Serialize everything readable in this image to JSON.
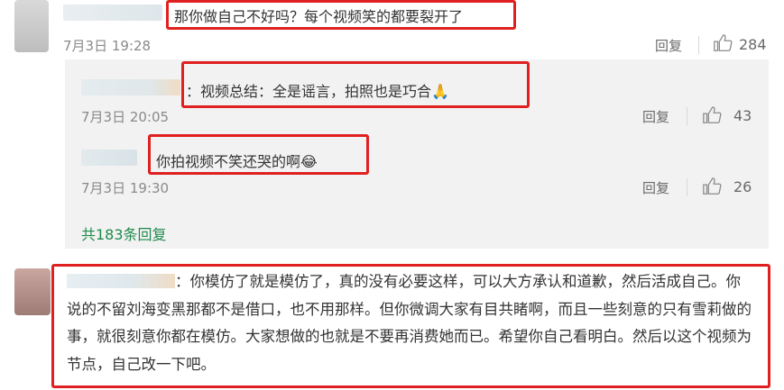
{
  "colors": {
    "highlight": "#e02020",
    "link": "#1f8a4c",
    "subpanel": "#f2f2f2"
  },
  "comment1": {
    "text": "那你做自己不好吗？每个视频笑的都要裂开了",
    "time": "7月3日 19:28",
    "reply_label": "回复",
    "likes": "284",
    "like_icon": "thumbs-up-icon"
  },
  "reply1": {
    "text": "：视频总结：全是谣言，拍照也是巧合🙏",
    "time": "7月3日 20:05",
    "reply_label": "回复",
    "likes": "43"
  },
  "reply2": {
    "text": "你拍视频不笑还哭的啊😂",
    "time": "7月3日 19:30",
    "reply_label": "回复",
    "likes": "26"
  },
  "replies_link": "共183条回复",
  "comment2": {
    "text": "：你模仿了就是模仿了，真的没有必要这样，可以大方承认和道歉，然后活成自己。你说的不留刘海变黑那都不是借口，也不用那样。但你微调大家有目共睹啊，而且一些刻意的只有雪莉做的事，就很刻意你都在模仿。大家想做的也就是不要再消费她而已。希望你自己看明白。然后以这个视频为节点，自己改一下吧。"
  }
}
